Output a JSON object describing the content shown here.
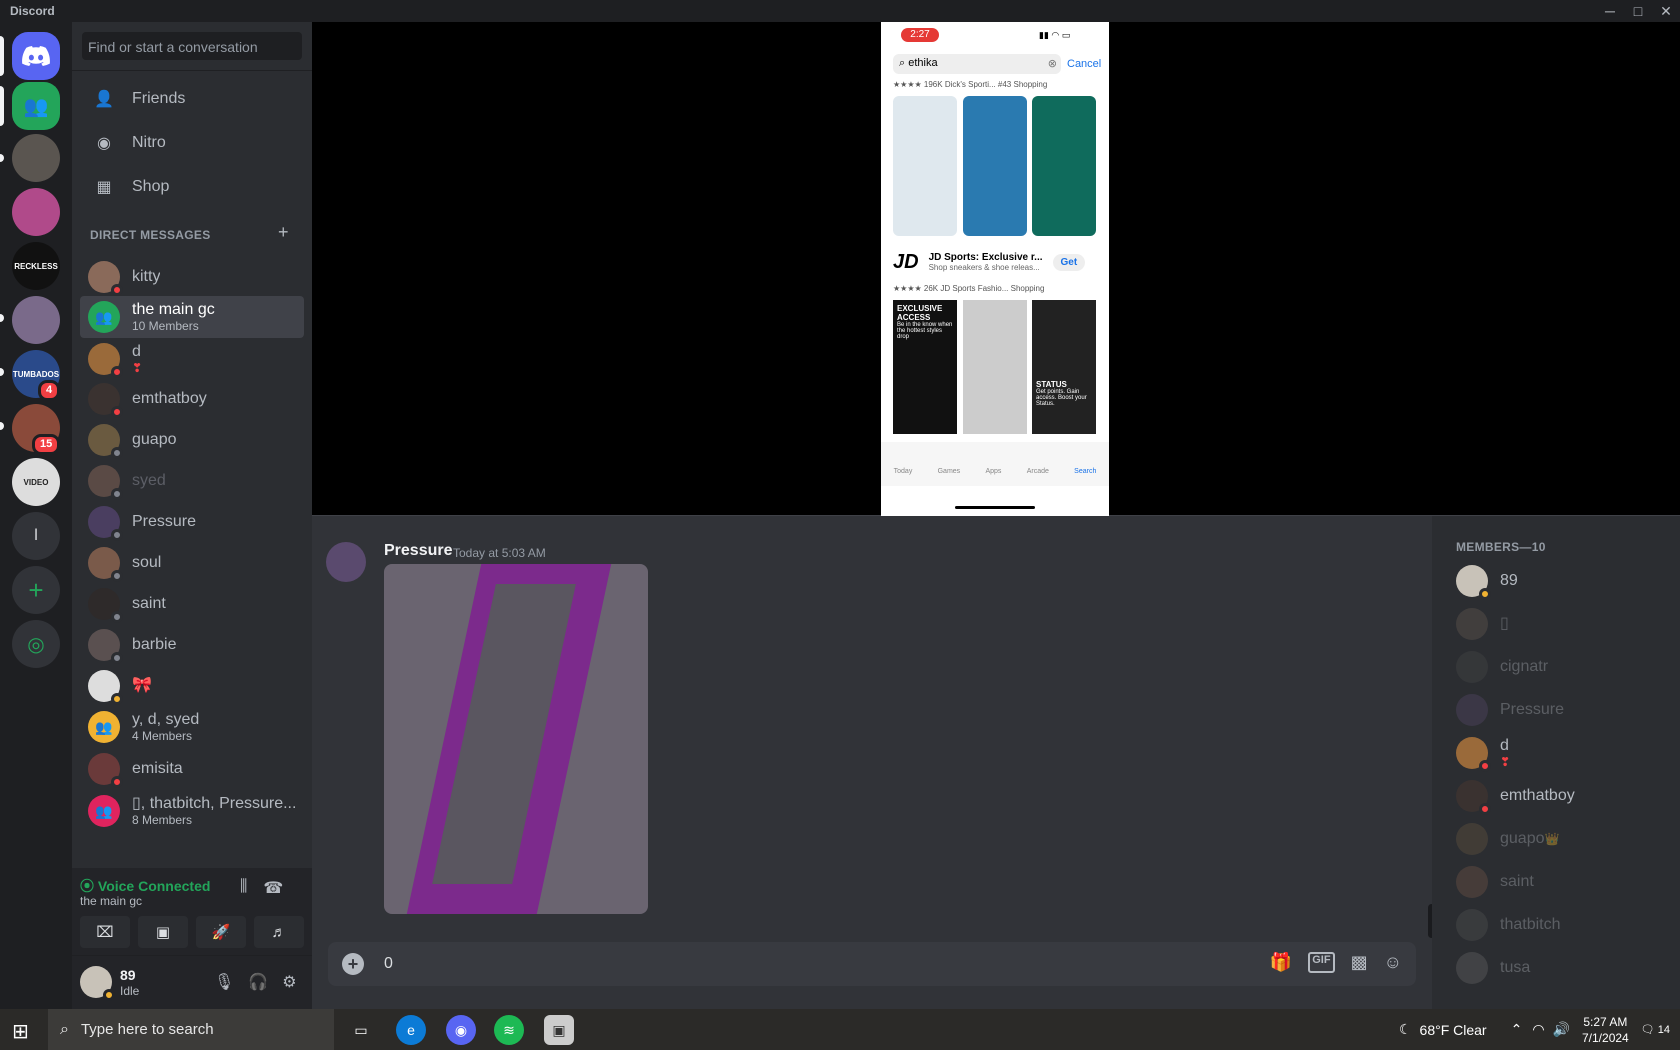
{
  "window": {
    "title": "Discord",
    "minimize": "─",
    "maximize": "□",
    "close": "✕"
  },
  "guilds": {
    "badges": [
      "4",
      "15"
    ],
    "server_letter": "l",
    "add": "+"
  },
  "sidebar": {
    "search_placeholder": "Find or start a conversation",
    "nav": [
      {
        "label": "Friends"
      },
      {
        "label": "Nitro"
      },
      {
        "label": "Shop"
      }
    ],
    "dm_header": "DIRECT MESSAGES",
    "dm_add": "+",
    "dms": [
      {
        "name": "kitty",
        "status": "dnd"
      },
      {
        "name": "the main gc",
        "sub": "10 Members",
        "group": true,
        "selected": true
      },
      {
        "name": "d",
        "sub": "❣",
        "status": "dnd"
      },
      {
        "name": "emthatboy",
        "status": "dnd"
      },
      {
        "name": "guapo",
        "status": "offline"
      },
      {
        "name": "syed",
        "status": "offline",
        "dim": true
      },
      {
        "name": "Pressure",
        "status": "offline"
      },
      {
        "name": "soul",
        "status": "offline"
      },
      {
        "name": "saint",
        "status": "offline"
      },
      {
        "name": "barbie",
        "status": "offline"
      },
      {
        "name": "🎀",
        "status": "idle"
      },
      {
        "name": "y, d, syed",
        "sub": "4 Members",
        "group": true
      },
      {
        "name": "emisita",
        "status": "dnd"
      },
      {
        "name": "▯, thatbitch, Pressure...",
        "sub": "8 Members",
        "group": true
      }
    ],
    "voice": {
      "status": "Voice Connected",
      "channel": "the main gc"
    },
    "user": {
      "name": "89",
      "status": "Idle"
    }
  },
  "stream": {
    "time": "2:27",
    "search_text": "ethika",
    "cancel": "Cancel",
    "top_meta": "★★★★ 196K   Dick's Sporti...   #43 Shopping",
    "jd": {
      "title": "JD Sports: Exclusive r...",
      "subtitle": "Shop sneakers & shoe releas...",
      "get": "Get",
      "meta": "★★★★ 26K   JD Sports Fashio...   Shopping",
      "shot1": "EXCLUSIVE ACCESS",
      "shot1_sub": "Be in the know when the hottest styles drop",
      "shot3": "STATUS",
      "shot3_sub": "Get points. Gain access. Boost your Status."
    },
    "tabs": [
      "Today",
      "Games",
      "Apps",
      "Arcade",
      "Search"
    ]
  },
  "message": {
    "author": "Pressure",
    "timestamp": "Today at 5:03 AM"
  },
  "composer": {
    "value": "0"
  },
  "members": {
    "header": "MEMBERS—10",
    "list": [
      {
        "name": "89",
        "status": "idle"
      },
      {
        "name": "▯",
        "offline": true
      },
      {
        "name": "cignatr",
        "offline": true
      },
      {
        "name": "Pressure",
        "offline": true
      },
      {
        "name": "d",
        "sub": "❣",
        "status": "dnd"
      },
      {
        "name": "emthatboy",
        "status": "dnd"
      },
      {
        "name": "guapo",
        "crown": "👑",
        "offline": true
      },
      {
        "name": "saint",
        "offline": true
      },
      {
        "name": "thatbitch",
        "offline": true
      },
      {
        "name": "tusa",
        "offline": true
      }
    ]
  },
  "taskbar": {
    "search_placeholder": "Type here to search",
    "weather": "68°F  Clear",
    "time": "5:27 AM",
    "date": "7/1/2024",
    "notif": "14"
  },
  "colors": {
    "accent": "#5865f2",
    "green": "#23a55a",
    "dnd": "#f23f43",
    "idle": "#f0b232"
  }
}
